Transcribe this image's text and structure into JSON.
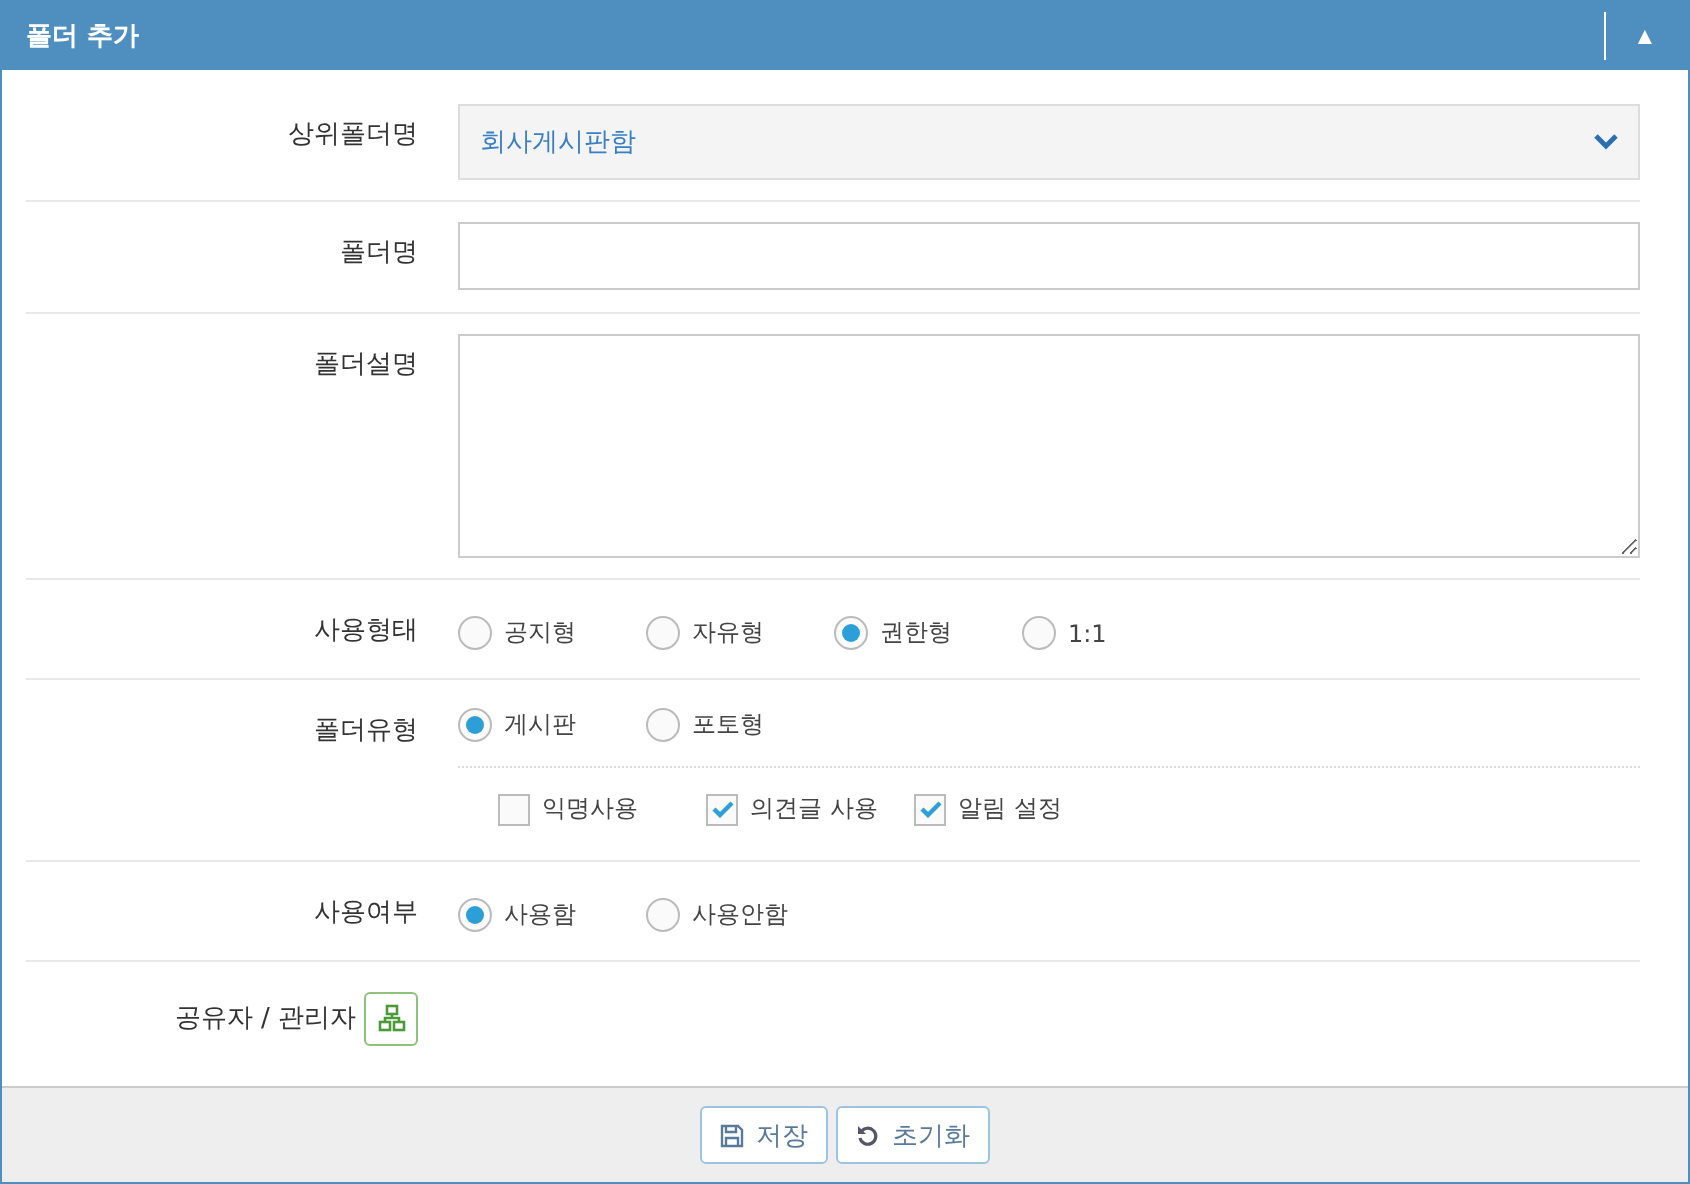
{
  "panel": {
    "title": "폴더 추가",
    "collapse_icon": "▲"
  },
  "form": {
    "parent_folder": {
      "label": "상위폴더명",
      "value": "회사게시판함"
    },
    "folder_name": {
      "label": "폴더명"
    },
    "folder_description": {
      "label": "폴더설명"
    },
    "usage_type": {
      "label": "사용형태",
      "options": [
        {
          "label": "공지형",
          "selected": false
        },
        {
          "label": "자유형",
          "selected": false
        },
        {
          "label": "권한형",
          "selected": true
        },
        {
          "label": "1:1",
          "selected": false
        }
      ]
    },
    "folder_type": {
      "label": "폴더유형",
      "options": [
        {
          "label": "게시판",
          "selected": true
        },
        {
          "label": "포토형",
          "selected": false
        }
      ],
      "checkboxes": [
        {
          "label": "익명사용",
          "checked": false
        },
        {
          "label": "의견글 사용",
          "checked": true
        },
        {
          "label": "알림 설정",
          "checked": true
        }
      ]
    },
    "in_use": {
      "label": "사용여부",
      "options": [
        {
          "label": "사용함",
          "selected": true
        },
        {
          "label": "사용안함",
          "selected": false
        }
      ]
    },
    "sharers": {
      "label": "공유자 / 관리자"
    }
  },
  "buttons": [
    {
      "kind": "save",
      "label": "저장"
    },
    {
      "kind": "reset",
      "label": "초기화"
    }
  ]
}
